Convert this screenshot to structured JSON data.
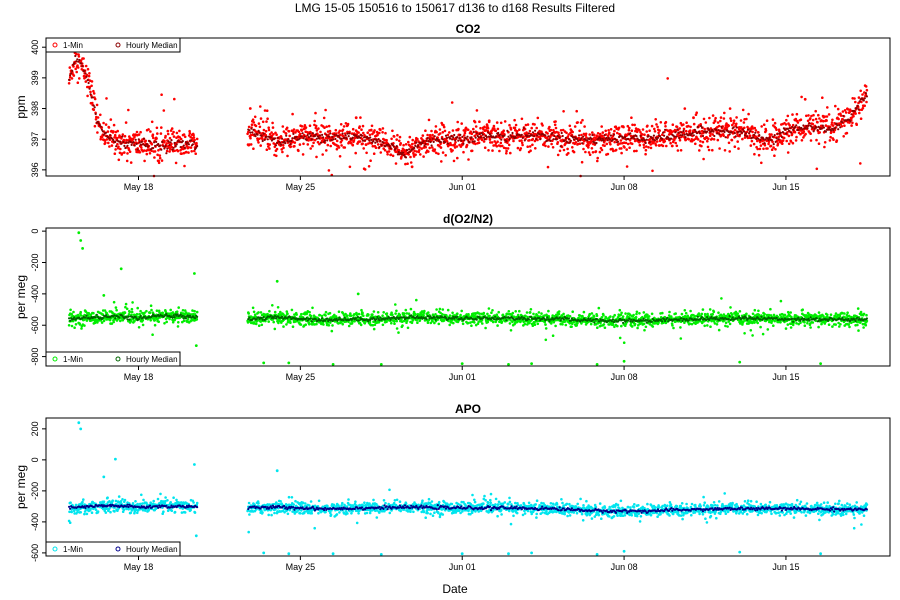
{
  "main_title": "LMG   15-05    150516 to 150617    d136 to d168   Results Filtered",
  "xlabel": "Date",
  "x_ticks": [
    {
      "date": "2015-05-18",
      "label": "May 18"
    },
    {
      "date": "2015-05-25",
      "label": "May 25"
    },
    {
      "date": "2015-06-01",
      "label": "Jun 01"
    },
    {
      "date": "2015-06-08",
      "label": "Jun 08"
    },
    {
      "date": "2015-06-15",
      "label": "Jun 15"
    }
  ],
  "xlim": [
    "2015-05-14T00:00",
    "2015-06-19T12:00"
  ],
  "data_gaps": [
    [
      "2015-05-20T13:00",
      "2015-05-22T17:00"
    ]
  ],
  "legend_labels": {
    "minute": "1-Min",
    "hourly": "Hourly Median"
  },
  "chart_data": [
    {
      "type": "scatter",
      "title": "CO2",
      "ylabel": "ppm",
      "ylim": [
        395.8,
        400.3
      ],
      "yticks": [
        396,
        397,
        398,
        399,
        400
      ],
      "legend_position": "top-left",
      "colors": {
        "minute": "#ff0000",
        "hourly": "#8b0000"
      },
      "series": [
        {
          "key": "minute",
          "name": "1-Min"
        },
        {
          "key": "hourly",
          "name": "Hourly Median"
        }
      ],
      "baseline_points": [
        [
          "2015-05-15T00:00",
          398.9
        ],
        [
          "2015-05-15T06:00",
          399.6
        ],
        [
          "2015-05-15T12:00",
          399.4
        ],
        [
          "2015-05-15T18:00",
          399.1
        ],
        [
          "2015-05-16T00:00",
          398.4
        ],
        [
          "2015-05-16T06:00",
          397.5
        ],
        [
          "2015-05-16T12:00",
          397.2
        ],
        [
          "2015-05-17T00:00",
          396.95
        ],
        [
          "2015-05-18T00:00",
          396.85
        ],
        [
          "2015-05-19T00:00",
          396.8
        ],
        [
          "2015-05-20T00:00",
          396.85
        ],
        [
          "2015-05-20T12:00",
          396.8
        ],
        [
          "2015-05-22T18:00",
          397.3
        ],
        [
          "2015-05-23T12:00",
          397.1
        ],
        [
          "2015-05-24T00:00",
          396.9
        ],
        [
          "2015-05-25T00:00",
          397.05
        ],
        [
          "2015-05-26T00:00",
          397.1
        ],
        [
          "2015-05-27T00:00",
          397.1
        ],
        [
          "2015-05-28T00:00",
          397.0
        ],
        [
          "2015-05-29T00:00",
          396.75
        ],
        [
          "2015-05-29T12:00",
          396.5
        ],
        [
          "2015-05-30T00:00",
          396.8
        ],
        [
          "2015-05-31T00:00",
          397.0
        ],
        [
          "2015-06-01T00:00",
          397.05
        ],
        [
          "2015-06-02T00:00",
          397.1
        ],
        [
          "2015-06-03T00:00",
          397.1
        ],
        [
          "2015-06-04T00:00",
          397.15
        ],
        [
          "2015-06-05T00:00",
          397.05
        ],
        [
          "2015-06-06T00:00",
          397.0
        ],
        [
          "2015-06-07T00:00",
          397.0
        ],
        [
          "2015-06-08T00:00",
          397.05
        ],
        [
          "2015-06-09T00:00",
          397.05
        ],
        [
          "2015-06-10T00:00",
          397.1
        ],
        [
          "2015-06-11T00:00",
          397.2
        ],
        [
          "2015-06-12T00:00",
          397.3
        ],
        [
          "2015-06-13T00:00",
          397.25
        ],
        [
          "2015-06-14T00:00",
          397.0
        ],
        [
          "2015-06-14T12:00",
          396.95
        ],
        [
          "2015-06-15T00:00",
          397.3
        ],
        [
          "2015-06-16T00:00",
          397.4
        ],
        [
          "2015-06-17T00:00",
          397.3
        ],
        [
          "2015-06-18T00:00",
          397.9
        ],
        [
          "2015-06-18T12:00",
          398.5
        ]
      ],
      "minute_scatter": 0.25,
      "hourly_scatter": 0.08,
      "outliers": [
        [
          "2015-05-15T05:00",
          400.2
        ],
        [
          "2015-05-22T20:00",
          398.0
        ],
        [
          "2015-05-27T10:00",
          397.7
        ],
        [
          "2015-06-02T04:00",
          397.6
        ],
        [
          "2015-06-11T00:00",
          397.7
        ],
        [
          "2015-06-15T20:00",
          398.3
        ],
        [
          "2015-05-29T20:00",
          396.1
        ]
      ]
    },
    {
      "type": "scatter",
      "title": "d(O2/N2)",
      "ylabel": "per meg",
      "ylim": [
        -860,
        20
      ],
      "yticks": [
        -800,
        -600,
        -400,
        -200,
        0
      ],
      "legend_position": "bottom-left",
      "colors": {
        "minute": "#00ee00",
        "hourly": "#006400"
      },
      "series": [
        {
          "key": "minute",
          "name": "1-Min"
        },
        {
          "key": "hourly",
          "name": "Hourly Median"
        }
      ],
      "baseline_points": [
        [
          "2015-05-15T00:00",
          -560
        ],
        [
          "2015-05-16T00:00",
          -550
        ],
        [
          "2015-05-17T00:00",
          -545
        ],
        [
          "2015-05-18T00:00",
          -555
        ],
        [
          "2015-05-19T00:00",
          -540
        ],
        [
          "2015-05-20T12:00",
          -545
        ],
        [
          "2015-05-22T18:00",
          -560
        ],
        [
          "2015-05-24T00:00",
          -550
        ],
        [
          "2015-05-26T00:00",
          -565
        ],
        [
          "2015-05-28T00:00",
          -560
        ],
        [
          "2015-05-30T00:00",
          -550
        ],
        [
          "2015-06-01T00:00",
          -555
        ],
        [
          "2015-06-03T00:00",
          -555
        ],
        [
          "2015-06-05T00:00",
          -560
        ],
        [
          "2015-06-07T00:00",
          -570
        ],
        [
          "2015-06-09T00:00",
          -570
        ],
        [
          "2015-06-11T00:00",
          -560
        ],
        [
          "2015-06-13T00:00",
          -555
        ],
        [
          "2015-06-15T00:00",
          -560
        ],
        [
          "2015-06-18T12:00",
          -565
        ]
      ],
      "minute_scatter": 22,
      "hourly_scatter": 6,
      "outliers": [
        [
          "2015-05-15T10:00",
          -10
        ],
        [
          "2015-05-15T12:00",
          -60
        ],
        [
          "2015-05-15T14:00",
          -110
        ],
        [
          "2015-05-17T06:00",
          -240
        ],
        [
          "2015-05-20T10:00",
          -270
        ],
        [
          "2015-05-20T12:00",
          -730
        ],
        [
          "2015-05-23T10:00",
          -840
        ],
        [
          "2015-05-24T00:00",
          -320
        ],
        [
          "2015-05-24T12:00",
          -840
        ],
        [
          "2015-05-26T10:00",
          -850
        ],
        [
          "2015-05-28T12:00",
          -850
        ],
        [
          "2015-06-01T00:00",
          -845
        ],
        [
          "2015-06-03T00:00",
          -850
        ],
        [
          "2015-06-04T00:00",
          -845
        ],
        [
          "2015-06-06T20:00",
          -850
        ],
        [
          "2015-06-08T00:00",
          -830
        ],
        [
          "2015-06-13T00:00",
          -835
        ],
        [
          "2015-06-16T12:00",
          -845
        ],
        [
          "2015-05-27T12:00",
          -400
        ],
        [
          "2015-05-16T12:00",
          -410
        ]
      ]
    },
    {
      "type": "scatter",
      "title": "APO",
      "ylabel": "per meg",
      "ylim": [
        -620,
        270
      ],
      "yticks": [
        -600,
        -400,
        -200,
        0,
        200
      ],
      "legend_position": "bottom-left",
      "colors": {
        "minute": "#00e5ee",
        "hourly": "#00008b"
      },
      "series": [
        {
          "key": "minute",
          "name": "1-Min"
        },
        {
          "key": "hourly",
          "name": "Hourly Median"
        }
      ],
      "baseline_points": [
        [
          "2015-05-15T00:00",
          -310
        ],
        [
          "2015-05-16T00:00",
          -300
        ],
        [
          "2015-05-17T00:00",
          -295
        ],
        [
          "2015-05-18T00:00",
          -305
        ],
        [
          "2015-05-19T00:00",
          -300
        ],
        [
          "2015-05-20T12:00",
          -300
        ],
        [
          "2015-05-22T18:00",
          -310
        ],
        [
          "2015-05-24T00:00",
          -305
        ],
        [
          "2015-05-26T00:00",
          -315
        ],
        [
          "2015-05-28T00:00",
          -310
        ],
        [
          "2015-05-30T00:00",
          -305
        ],
        [
          "2015-06-01T00:00",
          -310
        ],
        [
          "2015-06-03T00:00",
          -310
        ],
        [
          "2015-06-05T00:00",
          -315
        ],
        [
          "2015-06-07T00:00",
          -330
        ],
        [
          "2015-06-09T00:00",
          -330
        ],
        [
          "2015-06-11T00:00",
          -320
        ],
        [
          "2015-06-13T00:00",
          -315
        ],
        [
          "2015-06-15T00:00",
          -315
        ],
        [
          "2015-06-18T12:00",
          -320
        ]
      ],
      "minute_scatter": 20,
      "hourly_scatter": 5,
      "outliers": [
        [
          "2015-05-15T10:00",
          240
        ],
        [
          "2015-05-15T12:00",
          200
        ],
        [
          "2015-05-17T00:00",
          5
        ],
        [
          "2015-05-20T10:00",
          -30
        ],
        [
          "2015-05-20T12:00",
          -490
        ],
        [
          "2015-05-23T10:00",
          -600
        ],
        [
          "2015-05-24T00:00",
          -70
        ],
        [
          "2015-05-24T12:00",
          -605
        ],
        [
          "2015-05-26T10:00",
          -605
        ],
        [
          "2015-05-28T12:00",
          -610
        ],
        [
          "2015-06-01T00:00",
          -605
        ],
        [
          "2015-06-03T00:00",
          -605
        ],
        [
          "2015-06-04T00:00",
          -600
        ],
        [
          "2015-06-06T20:00",
          -610
        ],
        [
          "2015-06-08T00:00",
          -590
        ],
        [
          "2015-06-13T00:00",
          -595
        ],
        [
          "2015-06-16T12:00",
          -605
        ],
        [
          "2015-05-16T12:00",
          -110
        ]
      ]
    }
  ]
}
